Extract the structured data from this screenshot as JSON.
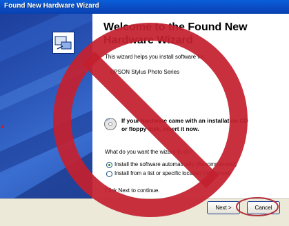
{
  "window": {
    "title": "Found New Hardware Wizard"
  },
  "wizard": {
    "heading": "Welcome to the Found New Hardware Wizard",
    "intro": "This wizard helps you install software for:",
    "device": "EPSON Stylus Photo Series",
    "cd_hint_line1": "If your hardware came with an installation CD",
    "cd_hint_line2": "or floppy disk, insert it now.",
    "question": "What do you want the wizard to do?",
    "options": [
      {
        "label": "Install the software automatically (Recommended)",
        "selected": true
      },
      {
        "label": "Install from a list or specific location (Advanced)",
        "selected": false
      }
    ],
    "continue_hint": "Click Next to continue."
  },
  "buttons": {
    "next": "Next >",
    "cancel": "Cancel"
  },
  "overlay": {
    "prohibition_color": "#c4202f",
    "cancel_highlight_color": "#b3323c"
  }
}
